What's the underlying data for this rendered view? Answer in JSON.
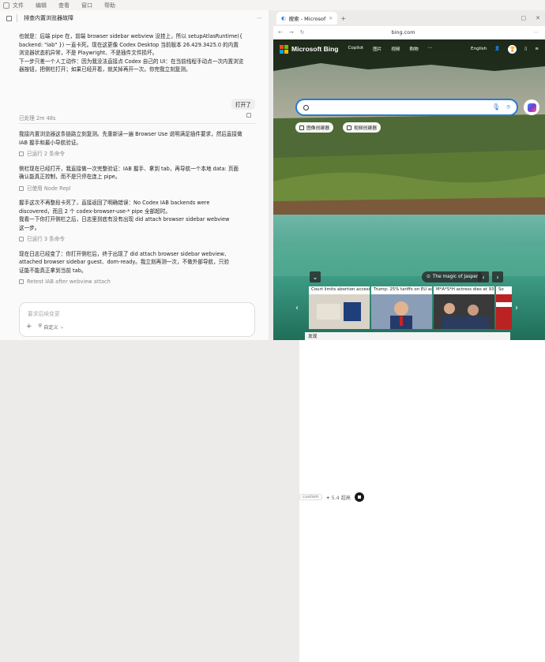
{
  "menubar": {
    "items": [
      "文件",
      "编辑",
      "查看",
      "窗口",
      "帮助"
    ]
  },
  "left": {
    "title": "排查内置浏览器故障",
    "messages": [
      {
        "kind": "text",
        "lines": [
          "也就是：后端 pipe 在，前端 browser sidebar webview 没挂上，所以 setupAtlasRuntime({",
          "backend: \"iab\" }) 一直卡死。现在这更像 Codex Desktop 当前版本 26.429.3425.0 的内置",
          "浏览器状态机异常，不是 Playwright、不是插件文件损坏。",
          "下一步只差一个人工动作：因为我没法直接点 Codex 自己的 UI：在当前线程手动点一次内置浏览",
          "器按钮，把侧栏打开；如果已经开着，就关掉再开一次。你完我立刻复测。"
        ]
      },
      {
        "kind": "user",
        "text": "打开了"
      },
      {
        "kind": "meta",
        "text": "已处理 2m 48s"
      },
      {
        "kind": "text",
        "lines": [
          "我接内置浏览器这条链路立刻复测。先重新读一遍 Browser Use 说明满足插件要求，然后直接做",
          "IAB 握手和最小导航验证。"
        ]
      },
      {
        "kind": "meta",
        "text": "已运行 2 条命令"
      },
      {
        "kind": "text",
        "lines": [
          "侧栏现在已经打开，我直接做一次完整验证：IAB 握手、拿到 tab，再导航一个本地 data: 页面",
          "确认能真正控制，而不是只停在连上 pipe。"
        ]
      },
      {
        "kind": "meta",
        "text": "已使用 Node Repl"
      },
      {
        "kind": "text",
        "lines": [
          "握手这次不再整段卡死了，直接返回了明确错误：No Codex IAB backends were",
          "discovered，而且 2 个 codex-browser-use-* pipe 全部超时。",
          "我看一下你打开侧栏之后，日志里到底有没有出现 did attach browser sidebar webview",
          "这一步。"
        ]
      },
      {
        "kind": "meta",
        "text": "已运行 3 条命令"
      },
      {
        "kind": "text",
        "lines": [
          "现在日志已经变了：你打开侧栏后，终于出现了 did attach browser sidebar webview、",
          "attached browser sidebar guest、dom-ready。我立刻再测一次，不做外部导航，只验",
          "证能不能真正拿到当前 tab。"
        ]
      },
      {
        "kind": "meta",
        "text": "Retest IAB after webview attach"
      }
    ],
    "composer": {
      "placeholder": "要求后续变更",
      "permission": "自定义",
      "chip": "custom",
      "model": "5.4",
      "mode": "超高"
    }
  },
  "browser": {
    "tab_title": "搜索 - Microsof",
    "url": "bing.com",
    "bing": {
      "brand": "Microsoft Bing",
      "nav": [
        "Copilot",
        "图片",
        "视频",
        "购物"
      ],
      "lang": "English",
      "gen_buttons": [
        "图像创建器",
        "视频创建器"
      ],
      "location_label": "The magic of Jasper",
      "news": [
        "Court limits abortion access",
        "Trump: 25% tariffs on EU aut...",
        "M*A*S*H actress dies at 93",
        "So"
      ],
      "discover": "发现"
    }
  },
  "colors": {
    "ms_red": "#f25022",
    "ms_green": "#7fba00",
    "ms_blue": "#00a4ef",
    "ms_yellow": "#ffb900",
    "accent": "#2a78d4"
  }
}
